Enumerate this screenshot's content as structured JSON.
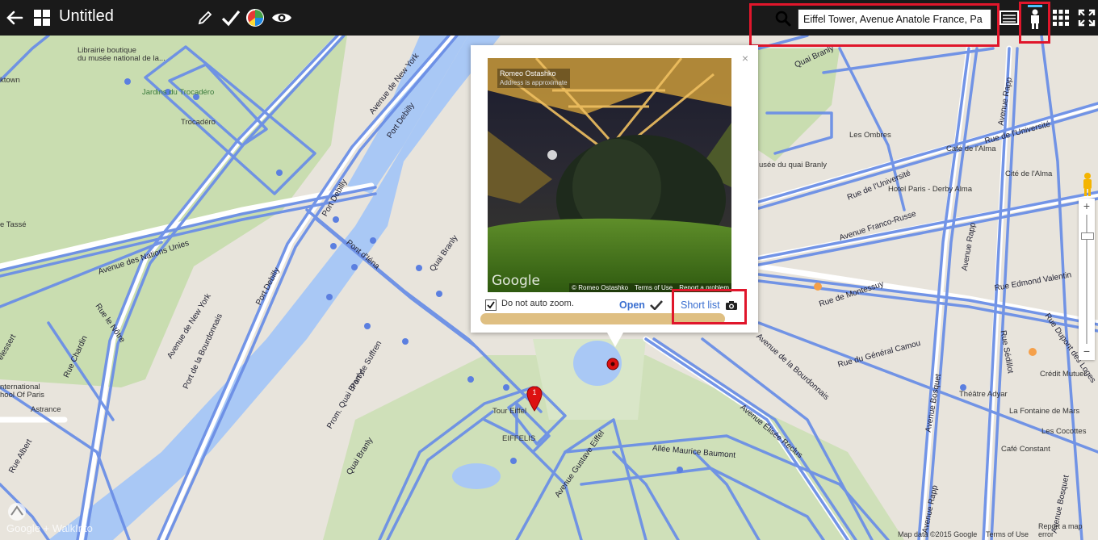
{
  "toolbar": {
    "title": "Untitled",
    "back_icon": "arrow-left-icon",
    "grid_icon": "grid-icon",
    "search_value": "Eiffel Tower, Avenue Anatole France, Pa"
  },
  "map": {
    "labels": [
      {
        "text": "Librairie boutique",
        "name": "label-librairie-1"
      },
      {
        "text": "du musée national de la...",
        "name": "label-librairie-2"
      },
      {
        "text": "ktown",
        "name": "label-ktown"
      },
      {
        "text": "Jardins du Trocadéro",
        "name": "label-jardins"
      },
      {
        "text": "Trocadéro",
        "name": "label-trocadero"
      },
      {
        "text": "Les Ombres",
        "name": "label-les-ombres"
      },
      {
        "text": "Café de l'Alma",
        "name": "label-cafe-alma"
      },
      {
        "text": "usée du quai Branly",
        "name": "label-musee-branly"
      },
      {
        "text": "Cité de l'Alma",
        "name": "label-cite-alma"
      },
      {
        "text": "Hotel Paris - Derby Alma",
        "name": "label-hotel-derby"
      },
      {
        "text": "e Tassé",
        "name": "label-tasse"
      },
      {
        "text": "Tour Eiffel",
        "name": "label-tour-eiffel"
      },
      {
        "text": "EIFFELIS",
        "name": "label-eiffelis"
      },
      {
        "text": "Crédit Mutuel",
        "name": "label-credit-mutuel"
      },
      {
        "text": "Théâtre Adyar",
        "name": "label-theatre-adyar"
      },
      {
        "text": "La Fontaine de Mars",
        "name": "label-fontaine-mars"
      },
      {
        "text": "Les Cocottes",
        "name": "label-cocottes"
      },
      {
        "text": "Café Constant",
        "name": "label-cafe-constant"
      },
      {
        "text": "Astrance",
        "name": "label-astrance"
      },
      {
        "text": "nternational",
        "name": "label-international-1"
      },
      {
        "text": "hool Of Paris",
        "name": "label-international-2"
      }
    ],
    "streets": [
      {
        "text": "Avenue de New York",
        "name": "street-new-york-1"
      },
      {
        "text": "Port Debilly",
        "name": "street-port-debilly-1"
      },
      {
        "text": "Avenue des Nations Unies",
        "name": "street-nations-unies"
      },
      {
        "text": "Pont d'Iéna",
        "name": "street-pont-iena"
      },
      {
        "text": "Port Debilly",
        "name": "street-port-debilly-2"
      },
      {
        "text": "Avenue de New York",
        "name": "street-new-york-2"
      },
      {
        "text": "Port Debilly",
        "name": "street-port-debilly-3"
      },
      {
        "text": "Port de Suffren",
        "name": "street-port-suffren"
      },
      {
        "text": "Port de la Bourdonnais",
        "name": "street-port-bourdonnais"
      },
      {
        "text": "Prom. Quai Branly",
        "name": "street-prom-branly"
      },
      {
        "text": "Quai Branly",
        "name": "street-quai-branly"
      },
      {
        "text": "Quai Branly",
        "name": "street-quai-branly-ne"
      },
      {
        "text": "Rue de l'Université",
        "name": "street-universite-1"
      },
      {
        "text": "Rue de l'Université",
        "name": "street-universite-2"
      },
      {
        "text": "Avenue Franco-Russe",
        "name": "street-franco-russe"
      },
      {
        "text": "Avenue Rapp",
        "name": "street-rapp"
      },
      {
        "text": "Rue de Montessuy",
        "name": "street-montessuy"
      },
      {
        "text": "Rue Edmond Valentin",
        "name": "street-edmond-valentin"
      },
      {
        "text": "Rue du Général Camou",
        "name": "street-general-camou"
      },
      {
        "text": "Avenue de la Bourdonnais",
        "name": "street-av-bourdonnais"
      },
      {
        "text": "Avenue Élisée Reclus",
        "name": "street-elisee-reclus"
      },
      {
        "text": "Allée Maurice Baumont",
        "name": "street-maurice-baumont"
      },
      {
        "text": "Avenue Gustave Eiffel",
        "name": "street-gustave-eiffel"
      },
      {
        "text": "Quai Branly",
        "name": "street-quai-branly-2"
      },
      {
        "text": "Rue le Nôtre",
        "name": "street-le-notre"
      },
      {
        "text": "Rue Chardin",
        "name": "street-chardin"
      },
      {
        "text": "Rue Albert",
        "name": "street-albert"
      },
      {
        "text": "Rue Sédillot",
        "name": "street-sedillot"
      },
      {
        "text": "Rue Dupont des Loges",
        "name": "street-dupont-loges"
      },
      {
        "text": "Avenue Rapp",
        "name": "street-rapp-2"
      },
      {
        "text": "Avenue Bosquet",
        "name": "street-bosquet"
      },
      {
        "text": "Avenue Bosquet",
        "name": "street-bosquet-2"
      },
      {
        "text": "Avenue Rapp",
        "name": "street-rapp-3"
      },
      {
        "text": "elessert",
        "name": "street-delessert"
      }
    ]
  },
  "popup": {
    "photo_author": "Romeo Ostashko",
    "photo_note": "Address is approximate",
    "photo_brand": "Google",
    "photo_credit": "© Romeo Ostashko",
    "photo_terms": "Terms of Use",
    "photo_report": "Report a problem",
    "checkbox_label": "Do not auto zoom.",
    "open_label": "Open",
    "shortlist_label": "Short list",
    "close_glyph": "×"
  },
  "marker": {
    "label": "1"
  },
  "footer": {
    "brand": "Google + WalkInto",
    "map_data": "Map data ©2015 Google",
    "terms": "Terms of Use",
    "report": "Report a map error"
  },
  "zoom": {
    "plus": "+",
    "minus": "−"
  },
  "colors": {
    "coverage": "#6b8fe6",
    "water": "#a9c8f5",
    "park": "#c9ddb0",
    "road": "#ffffff",
    "highlight": "#e0162b",
    "topbar": "#1a1a1a",
    "progress": "#dfbf82"
  }
}
